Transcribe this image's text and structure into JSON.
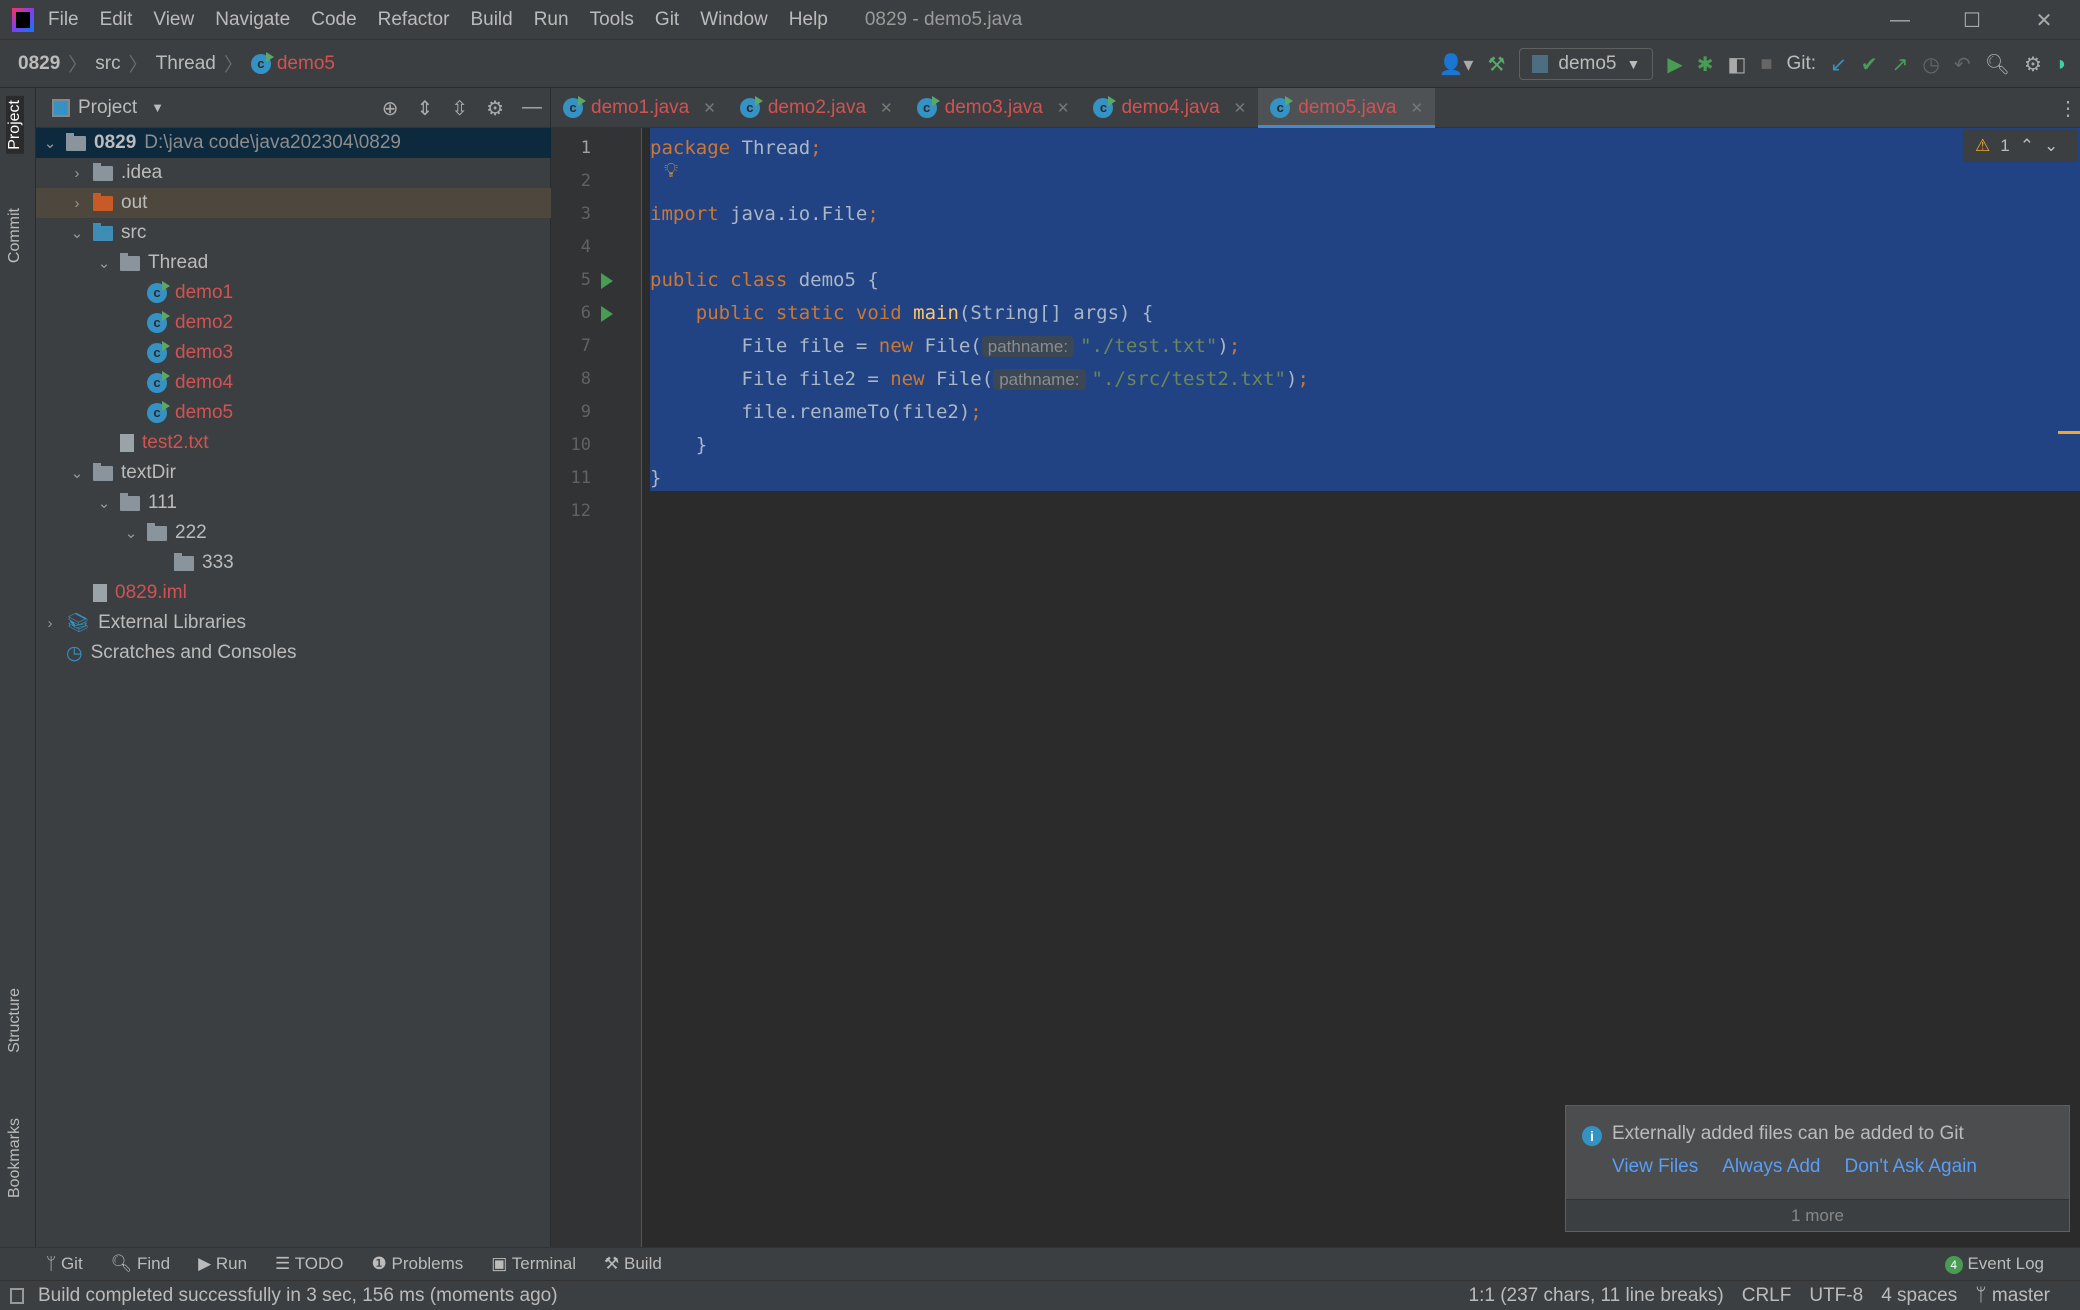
{
  "window": {
    "title": "0829 - demo5.java",
    "menu": [
      "File",
      "Edit",
      "View",
      "Navigate",
      "Code",
      "Refactor",
      "Build",
      "Run",
      "Tools",
      "Git",
      "Window",
      "Help"
    ]
  },
  "breadcrumb": [
    "0829",
    "src",
    "Thread",
    "demo5"
  ],
  "toolbar": {
    "run_config": "demo5",
    "git_label": "Git:"
  },
  "project": {
    "title": "Project",
    "tree": [
      {
        "label": "0829",
        "extra": "D:\\java code\\java202304\\0829",
        "depth": 0,
        "chev": "v",
        "icon": "module",
        "color": "#bbbbbb"
      },
      {
        "label": ".idea",
        "depth": 1,
        "chev": ">",
        "icon": "folder",
        "color": "#bbbbbb"
      },
      {
        "label": "out",
        "depth": 1,
        "chev": ">",
        "icon": "folder-orange",
        "color": "#bbbbbb"
      },
      {
        "label": "src",
        "depth": 1,
        "chev": "v",
        "icon": "folder-blue",
        "color": "#bbbbbb"
      },
      {
        "label": "Thread",
        "depth": 2,
        "chev": "v",
        "icon": "package",
        "color": "#bbbbbb"
      },
      {
        "label": "demo1",
        "depth": 3,
        "icon": "class",
        "color": "#d25252"
      },
      {
        "label": "demo2",
        "depth": 3,
        "icon": "class",
        "color": "#d25252"
      },
      {
        "label": "demo3",
        "depth": 3,
        "icon": "class",
        "color": "#d25252"
      },
      {
        "label": "demo4",
        "depth": 3,
        "icon": "class",
        "color": "#d25252"
      },
      {
        "label": "demo5",
        "depth": 3,
        "icon": "class",
        "color": "#d25252"
      },
      {
        "label": "test2.txt",
        "depth": 2,
        "icon": "file",
        "color": "#d25252"
      },
      {
        "label": "textDir",
        "depth": 1,
        "chev": "v",
        "icon": "folder",
        "color": "#bbbbbb"
      },
      {
        "label": "111",
        "depth": 2,
        "chev": "v",
        "icon": "folder",
        "color": "#bbbbbb"
      },
      {
        "label": "222",
        "depth": 3,
        "chev": "v",
        "icon": "folder",
        "color": "#bbbbbb"
      },
      {
        "label": "333",
        "depth": 4,
        "icon": "folder",
        "color": "#bbbbbb"
      },
      {
        "label": "0829.iml",
        "depth": 1,
        "icon": "file",
        "color": "#d25252"
      },
      {
        "label": "External Libraries",
        "depth": 0,
        "chev": ">",
        "icon": "library",
        "color": "#bbbbbb"
      },
      {
        "label": "Scratches and Consoles",
        "depth": 0,
        "icon": "scratches",
        "color": "#bbbbbb"
      }
    ]
  },
  "side_tabs": {
    "project": "Project",
    "commit": "Commit",
    "structure": "Structure",
    "bookmarks": "Bookmarks"
  },
  "tabs": [
    "demo1.java",
    "demo2.java",
    "demo3.java",
    "demo4.java",
    "demo5.java"
  ],
  "active_tab": 4,
  "editor": {
    "warnings": "1",
    "lines": [
      {
        "n": "1",
        "html": "<span class='kw'>package</span> Thread<span class='kw'>;</span>"
      },
      {
        "n": "2",
        "html": ""
      },
      {
        "n": "3",
        "html": "<span class='kw'>import</span> java.io.File<span class='kw'>;</span>"
      },
      {
        "n": "4",
        "html": ""
      },
      {
        "n": "5",
        "html": "<span class='kw'>public class</span> demo5 {"
      },
      {
        "n": "6",
        "html": "    <span class='kw'>public static void</span> <span class='fn'>main</span>(String[] args) {"
      },
      {
        "n": "7",
        "html": "        File file = <span class='kw'>new</span> File(<span class='hint'>pathname:</span><span class='str'>\"./test.txt\"</span>)<span class='kw'>;</span>"
      },
      {
        "n": "8",
        "html": "        File file2 = <span class='kw'>new</span> File(<span class='hint'>pathname:</span><span class='str'>\"./src/test2.txt\"</span>)<span class='kw'>;</span>"
      },
      {
        "n": "9",
        "html": "        file.renameTo(file2)<span class='kw'>;</span>"
      },
      {
        "n": "10",
        "html": "    }"
      },
      {
        "n": "11",
        "html": "}"
      },
      {
        "n": "12",
        "html": ""
      }
    ]
  },
  "notification": {
    "message": "Externally added files can be added to Git",
    "links": [
      "View Files",
      "Always Add",
      "Don't Ask Again"
    ],
    "more": "1 more"
  },
  "bottom_tools": [
    "Git",
    "Find",
    "Run",
    "TODO",
    "Problems",
    "Terminal",
    "Build"
  ],
  "event_log": {
    "label": "Event Log",
    "count": "4"
  },
  "status": {
    "message": "Build completed successfully in 3 sec, 156 ms (moments ago)",
    "position": "1:1 (237 chars, 11 line breaks)",
    "line_sep": "CRLF",
    "encoding": "UTF-8",
    "indent": "4 spaces",
    "branch": "master"
  }
}
